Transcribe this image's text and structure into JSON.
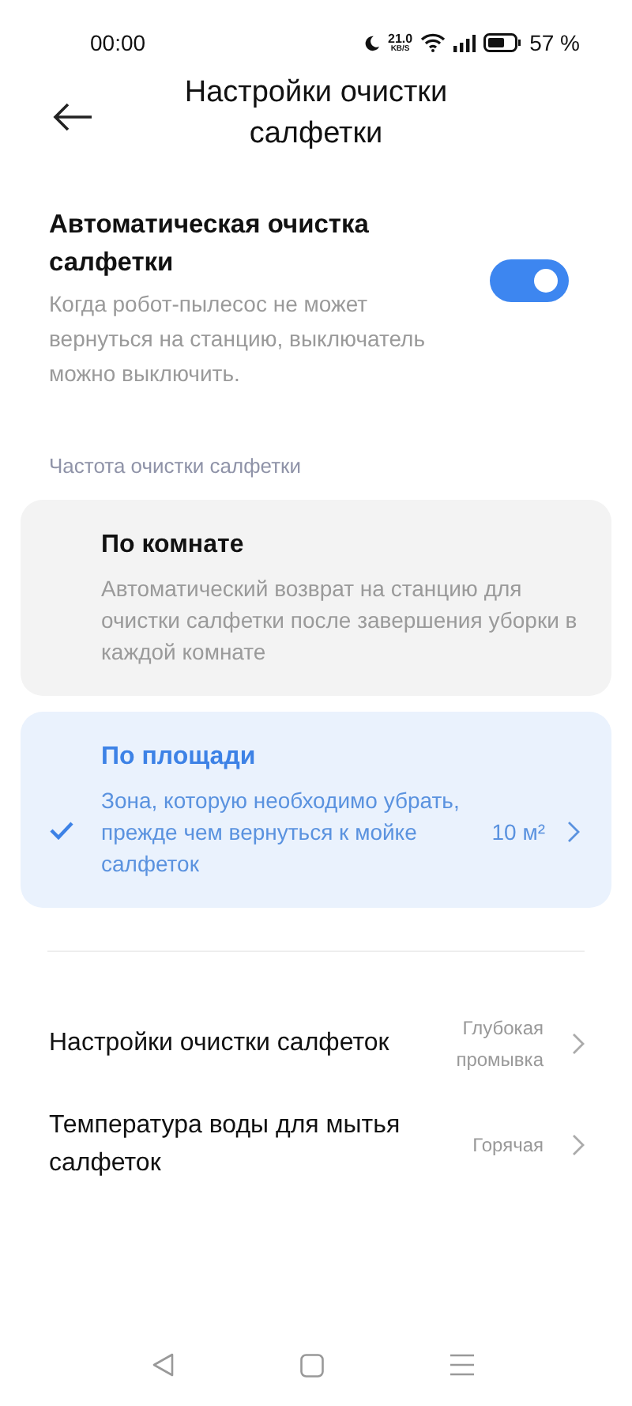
{
  "status_bar": {
    "time": "00:00",
    "speed": "21.0",
    "speed_unit": "KB/S",
    "battery": "57 %"
  },
  "header": {
    "title": "Настройки очистки салфетки"
  },
  "auto_clean": {
    "title": "Автоматическая очистка салфетки",
    "description": "Когда робот-пылесос не может вернуться на станцию, выключатель можно выключить.",
    "on": true
  },
  "frequency": {
    "label": "Частота очистки салфетки",
    "options": [
      {
        "title": "По комнате",
        "description": "Автоматический возврат на станцию для очистки салфетки после завершения уборки в каждой комнате",
        "selected": false
      },
      {
        "title": "По площади",
        "description": "Зона, которую необходимо убрать, прежде чем вернуться к мойке салфеток",
        "value": "10 м²",
        "selected": true
      }
    ]
  },
  "settings": [
    {
      "label": "Настройки очистки салфеток",
      "value": "Глубокая промывка"
    },
    {
      "label": "Температура воды для мытья салфеток",
      "value": "Горячая"
    }
  ]
}
